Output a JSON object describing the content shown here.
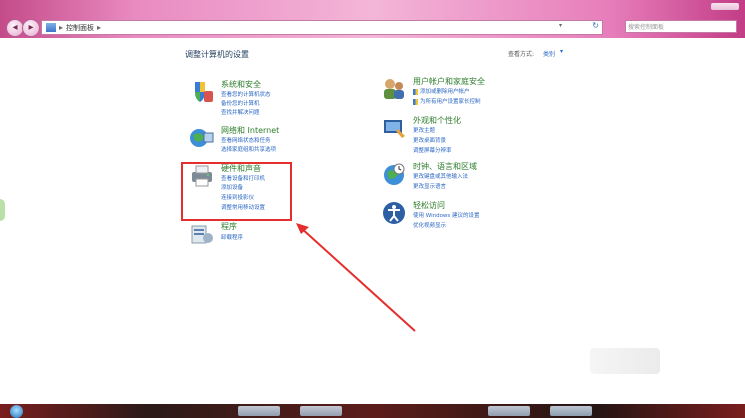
{
  "window": {
    "breadcrumb_separator": "▸",
    "address_path": "控制面板",
    "address_dropdown": "▾",
    "search_placeholder": "搜索控制面板"
  },
  "header": {
    "title": "调整计算机的设置",
    "view_by_label": "查看方式:",
    "view_by_value": "类别",
    "view_by_arrow": "▾"
  },
  "categories": [
    {
      "title": "系统和安全",
      "links": [
        "查看您的计算机状态",
        "备份您的计算机",
        "查找并解决问题"
      ],
      "icon": "shield-flag-icon"
    },
    {
      "title": "网络和 Internet",
      "links": [
        "查看网络状态和任务",
        "选择家庭组和共享选项"
      ],
      "icon": "network-globe-icon"
    },
    {
      "title": "硬件和声音",
      "links": [
        "查看设备和打印机",
        "添加设备",
        "连接到投影仪",
        "调整常用移动设置"
      ],
      "icon": "printer-icon"
    },
    {
      "title": "程序",
      "links": [
        "卸载程序"
      ],
      "icon": "programs-icon"
    },
    {
      "title": "用户帐户和家庭安全",
      "links": [
        "添加或删除用户帐户",
        "为所有用户设置家长控制"
      ],
      "icon": "users-icon"
    },
    {
      "title": "外观和个性化",
      "links": [
        "更改主题",
        "更改桌面背景",
        "调整屏幕分辨率"
      ],
      "icon": "appearance-icon"
    },
    {
      "title": "时钟、语言和区域",
      "links": [
        "更改键盘或其他输入法",
        "更改显示语言"
      ],
      "icon": "clock-globe-icon"
    },
    {
      "title": "轻松访问",
      "links": [
        "使用 Windows 建议的设置",
        "优化视频显示"
      ],
      "icon": "ease-of-access-icon"
    }
  ],
  "colors": {
    "category_title": "#2d7d2b",
    "link": "#2a67c4",
    "highlight": "#e52f2f"
  }
}
